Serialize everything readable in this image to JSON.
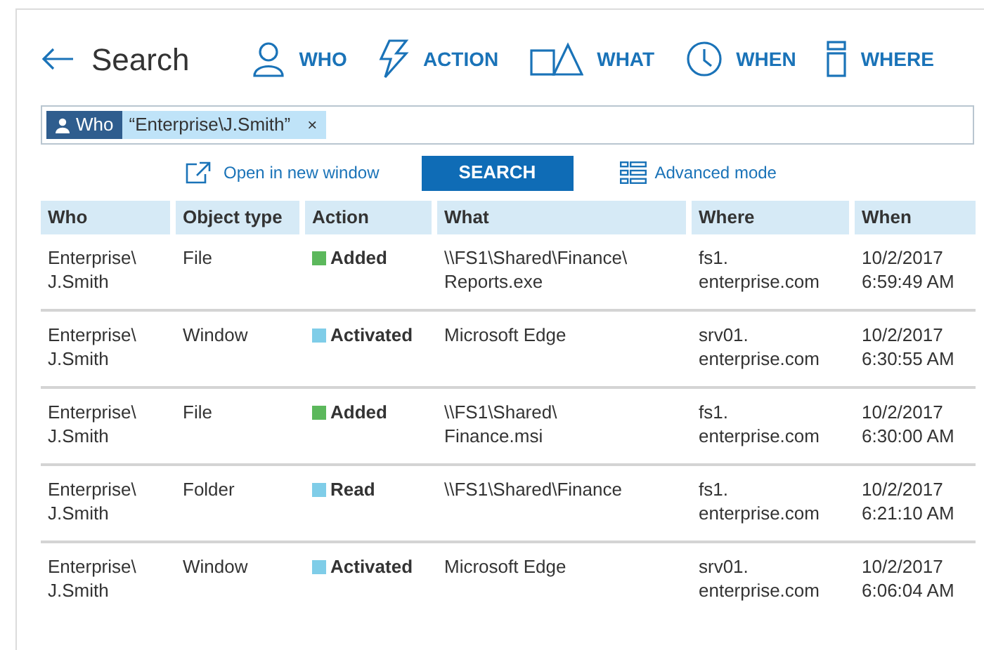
{
  "header": {
    "title": "Search"
  },
  "nav": [
    {
      "kind": "who",
      "label": "WHO"
    },
    {
      "kind": "action",
      "label": "ACTION"
    },
    {
      "kind": "what",
      "label": "WHAT"
    },
    {
      "kind": "when",
      "label": "WHEN"
    },
    {
      "kind": "where",
      "label": "WHERE"
    }
  ],
  "search_field": {
    "filter": {
      "label": "Who",
      "value": "“Enterprise\\J.Smith”",
      "remove": "×"
    }
  },
  "links": {
    "open_new": "Open in new window",
    "search_button": "SEARCH",
    "advanced": "Advanced mode"
  },
  "table": {
    "columns": [
      "Who",
      "Object type",
      "Action",
      "What",
      "Where",
      "When"
    ],
    "rows": [
      {
        "who": "Enterprise\\\nJ.Smith",
        "object_type": "File",
        "action": "Added",
        "color": "#5cb85c",
        "what": "\\\\FS1\\Shared\\Finance\\\nReports.exe",
        "where": "fs1.\nenterprise.com",
        "when": "10/2/2017\n6:59:49 AM"
      },
      {
        "who": "Enterprise\\\nJ.Smith",
        "object_type": "Window",
        "action": "Activated",
        "color": "#7fcde8",
        "what": "Microsoft Edge",
        "where": "srv01.\nenterprise.com",
        "when": "10/2/2017\n6:30:55 AM"
      },
      {
        "who": "Enterprise\\\nJ.Smith",
        "object_type": "File",
        "action": "Added",
        "color": "#5cb85c",
        "what": "\\\\FS1\\Shared\\\nFinance.msi",
        "where": "fs1.\nenterprise.com",
        "when": "10/2/2017\n6:30:00 AM"
      },
      {
        "who": "Enterprise\\\nJ.Smith",
        "object_type": "Folder",
        "action": "Read",
        "color": "#7fcde8",
        "what": "\\\\FS1\\Shared\\Finance",
        "where": "fs1.\nenterprise.com",
        "when": "10/2/2017\n6:21:10 AM"
      },
      {
        "who": "Enterprise\\\nJ.Smith",
        "object_type": "Window",
        "action": "Activated",
        "color": "#7fcde8",
        "what": "Microsoft Edge",
        "where": "srv01.\nenterprise.com",
        "when": "10/2/2017\n6:06:04 AM"
      }
    ]
  }
}
